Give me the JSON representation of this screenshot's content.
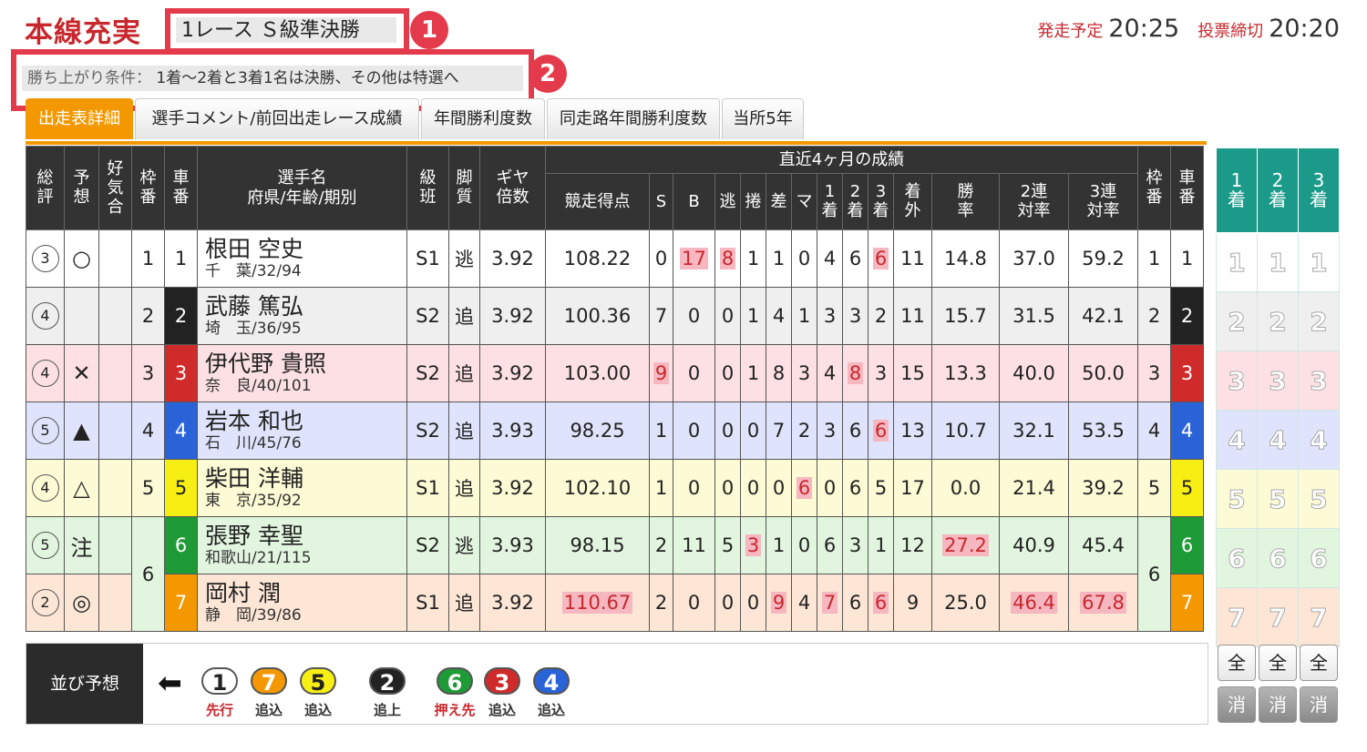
{
  "header": {
    "title": "本線充実",
    "race_label": "1レース Ｓ級準決勝",
    "badge1": "1",
    "badge2": "2",
    "condition_label": "勝ち上がり条件：",
    "condition_text": "1着〜2着と3着1名は決勝、その他は特選へ",
    "start_label": "発走予定",
    "start_time": "20:25",
    "close_label": "投票締切",
    "close_time": "20:20"
  },
  "tabs": [
    {
      "label": "出走表詳細",
      "active": true
    },
    {
      "label": "選手コメント/前回出走レース成績",
      "active": false
    },
    {
      "label": "年間勝利度数",
      "active": false
    },
    {
      "label": "同走路年間勝利度数",
      "active": false
    },
    {
      "label": "当所5年",
      "active": false
    }
  ],
  "table": {
    "h_sohyo": "総評",
    "h_yoso": "予想",
    "h_kouki": "好気合",
    "h_waku": "枠番",
    "h_sha": "車番",
    "h_name": "選手名",
    "h_name_sub": "府県/年齢/期別",
    "h_kyu": "級班",
    "h_kyaku": "脚質",
    "h_gear": "ギヤ倍数",
    "h_recent": "直近4ヶ月の成績",
    "h_score": "競走得点",
    "h_s": "S",
    "h_b": "B",
    "h_nige": "逃",
    "h_makuri": "捲",
    "h_sashi": "差",
    "h_ma": "マ",
    "h_1": "1着",
    "h_2": "2着",
    "h_3": "3着",
    "h_out": "着外",
    "h_win": "勝率",
    "h_2ren": "2連対率",
    "h_3ren": "3連対率",
    "h_waku2": "枠番",
    "h_sha2": "車番"
  },
  "riders": [
    {
      "sohyo": "3",
      "yoso": "○",
      "waku": "1",
      "sha": "1",
      "name": "根田 空史",
      "pref": "千　葉/32/94",
      "kyu": "S1",
      "kyaku": "逃",
      "gear": "3.92",
      "score": "108.22",
      "s": "0",
      "b": "17",
      "nige": "8",
      "makuri": "1",
      "sashi": "1",
      "ma": "0",
      "r1": "4",
      "r2": "6",
      "r3": "6",
      "out": "11",
      "win": "14.8",
      "ren2": "37.0",
      "ren3": "59.2"
    },
    {
      "sohyo": "4",
      "yoso": "",
      "waku": "2",
      "sha": "2",
      "name": "武藤 篤弘",
      "pref": "埼　玉/36/95",
      "kyu": "S2",
      "kyaku": "追",
      "gear": "3.92",
      "score": "100.36",
      "s": "7",
      "b": "0",
      "nige": "0",
      "makuri": "1",
      "sashi": "4",
      "ma": "1",
      "r1": "3",
      "r2": "3",
      "r3": "2",
      "out": "11",
      "win": "15.7",
      "ren2": "31.5",
      "ren3": "42.1"
    },
    {
      "sohyo": "4",
      "yoso": "✕",
      "waku": "3",
      "sha": "3",
      "name": "伊代野 貴照",
      "pref": "奈　良/40/101",
      "kyu": "S2",
      "kyaku": "追",
      "gear": "3.92",
      "score": "103.00",
      "s": "9",
      "b": "0",
      "nige": "0",
      "makuri": "1",
      "sashi": "8",
      "ma": "3",
      "r1": "4",
      "r2": "8",
      "r3": "3",
      "out": "15",
      "win": "13.3",
      "ren2": "40.0",
      "ren3": "50.0"
    },
    {
      "sohyo": "5",
      "yoso": "▲",
      "waku": "4",
      "sha": "4",
      "name": "岩本 和也",
      "pref": "石　川/45/76",
      "kyu": "S2",
      "kyaku": "追",
      "gear": "3.93",
      "score": "98.25",
      "s": "1",
      "b": "0",
      "nige": "0",
      "makuri": "0",
      "sashi": "7",
      "ma": "2",
      "r1": "3",
      "r2": "6",
      "r3": "6",
      "out": "13",
      "win": "10.7",
      "ren2": "32.1",
      "ren3": "53.5"
    },
    {
      "sohyo": "4",
      "yoso": "△",
      "waku": "5",
      "sha": "5",
      "name": "柴田 洋輔",
      "pref": "東　京/35/92",
      "kyu": "S1",
      "kyaku": "追",
      "gear": "3.92",
      "score": "102.10",
      "s": "1",
      "b": "0",
      "nige": "0",
      "makuri": "0",
      "sashi": "0",
      "ma": "6",
      "r1": "0",
      "r2": "6",
      "r3": "5",
      "out": "17",
      "win": "0.0",
      "ren2": "21.4",
      "ren3": "39.2"
    },
    {
      "sohyo": "5",
      "yoso": "注",
      "waku": "6",
      "sha": "6",
      "name": "張野 幸聖",
      "pref": "和歌山/21/115",
      "kyu": "S2",
      "kyaku": "逃",
      "gear": "3.93",
      "score": "98.15",
      "s": "2",
      "b": "11",
      "nige": "5",
      "makuri": "3",
      "sashi": "1",
      "ma": "0",
      "r1": "6",
      "r2": "3",
      "r3": "1",
      "out": "12",
      "win": "27.2",
      "ren2": "40.9",
      "ren3": "45.4"
    },
    {
      "sohyo": "2",
      "yoso": "◎",
      "waku": "6",
      "sha": "7",
      "name": "岡村 潤",
      "pref": "静　岡/39/86",
      "kyu": "S1",
      "kyaku": "追",
      "gear": "3.92",
      "score": "110.67",
      "s": "2",
      "b": "0",
      "nige": "0",
      "makuri": "0",
      "sashi": "9",
      "ma": "4",
      "r1": "7",
      "r2": "6",
      "r3": "6",
      "out": "9",
      "win": "25.0",
      "ren2": "46.4",
      "ren3": "67.8"
    }
  ],
  "rank_headers": [
    "1着",
    "2着",
    "3着"
  ],
  "colors": {
    "row_bg": [
      "#ffffff",
      "#efefef",
      "#fde0e3",
      "#dfe3fb",
      "#fdfbd5",
      "#e2f5df",
      "#fde6d6"
    ],
    "car_bg": [
      "#ffffff",
      "#222222",
      "#d02b2b",
      "#2a62d8",
      "#f7ef14",
      "#1e9a36",
      "#f39800"
    ],
    "car_fg": [
      "#222222",
      "#ffffff",
      "#ffffff",
      "#ffffff",
      "#222222",
      "#ffffff",
      "#ffffff"
    ],
    "accent": "#f39800",
    "brand_red": "#c8282d",
    "teal": "#1b9a8a"
  },
  "narabi": {
    "label": "並び予想",
    "arrow": "⬅",
    "items": [
      {
        "num": "1",
        "type": "先行",
        "red": true
      },
      {
        "num": "7",
        "type": "追込",
        "red": false
      },
      {
        "num": "5",
        "type": "追込",
        "red": false
      },
      {
        "num": "2",
        "type": "追上",
        "red": false
      },
      {
        "num": "6",
        "type": "押え先",
        "red": true
      },
      {
        "num": "3",
        "type": "追込",
        "red": false
      },
      {
        "num": "4",
        "type": "追込",
        "red": false
      }
    ]
  },
  "buttons": {
    "all": "全",
    "clear": "消"
  }
}
